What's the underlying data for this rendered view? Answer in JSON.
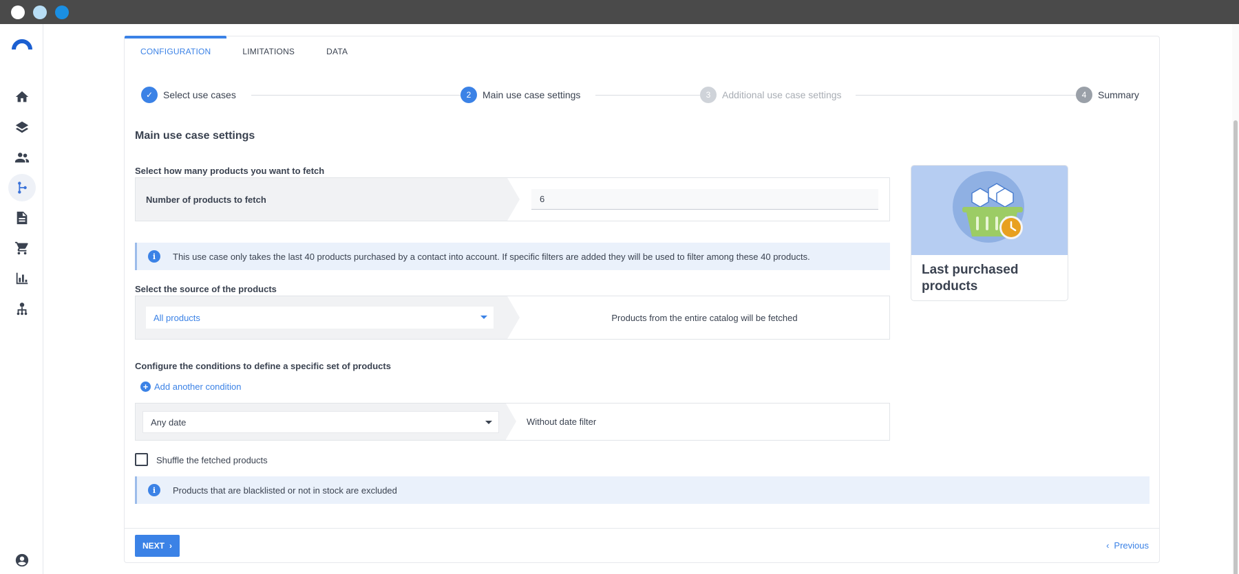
{
  "tabs": [
    {
      "label": "CONFIGURATION"
    },
    {
      "label": "LIMITATIONS"
    },
    {
      "label": "DATA"
    }
  ],
  "steps": [
    {
      "number": "✓",
      "label": "Select use cases",
      "state": "done"
    },
    {
      "number": "2",
      "label": "Main use case settings",
      "state": "current"
    },
    {
      "number": "3",
      "label": "Additional use case settings",
      "state": "future"
    },
    {
      "number": "4",
      "label": "Summary",
      "state": "future"
    }
  ],
  "main": {
    "title": "Main use case settings",
    "fetch": {
      "label": "Select how many products you want to fetch",
      "field_label": "Number of products to fetch",
      "value": "6"
    },
    "info1": "This use case only takes the last 40 products purchased by a contact into account. If specific filters are added they will be used to filter among these 40 products.",
    "source": {
      "label": "Select the source of the products",
      "selected": "All products",
      "description": "Products from the entire catalog will be fetched"
    },
    "conditions": {
      "label": "Configure the conditions to define a specific set of products",
      "add_link": "Add another condition",
      "date_selected": "Any date",
      "date_description": "Without date filter"
    },
    "shuffle_label": "Shuffle the fetched products",
    "shuffle_checked": false,
    "info2": "Products that are blacklisted or not in stock are excluded"
  },
  "footer": {
    "next_label": "NEXT",
    "previous_label": "Previous"
  },
  "illustration": {
    "title": "Last purchased products"
  },
  "colors": {
    "accent": "#3b82e6",
    "titlebar": "#4a4a4a",
    "info_bg": "#eaf1fb"
  }
}
